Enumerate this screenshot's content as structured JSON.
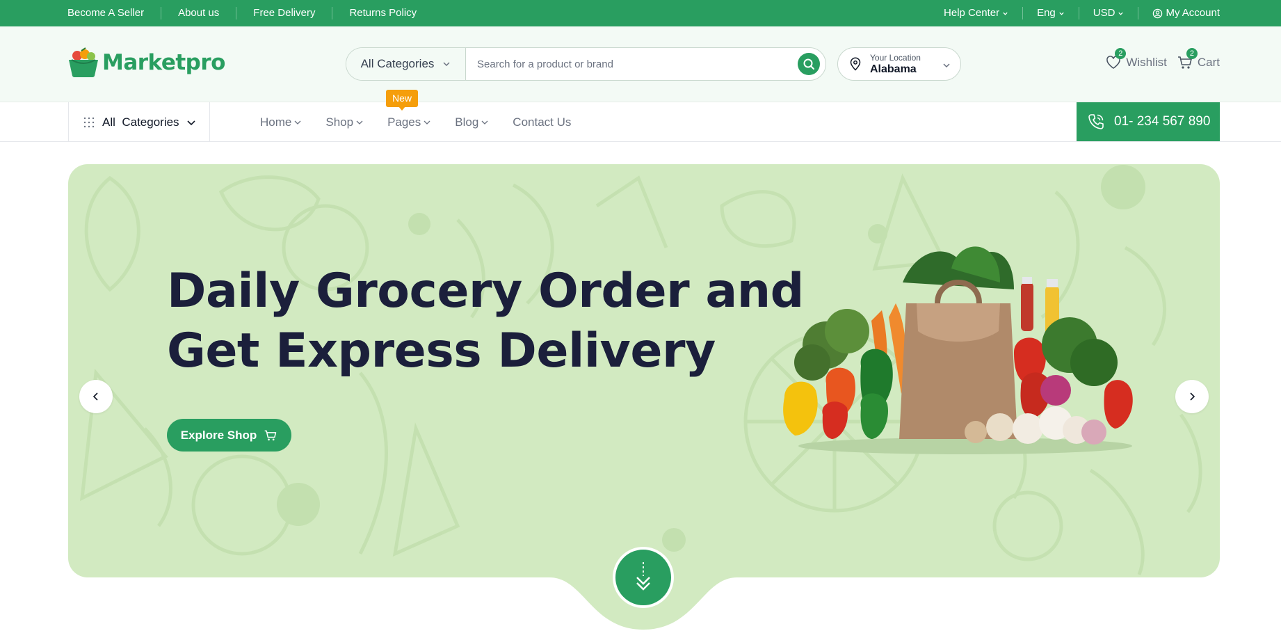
{
  "topbar": {
    "links": [
      "Become A Seller",
      "About us",
      "Free Delivery",
      "Returns Policy"
    ],
    "help_center": "Help Center",
    "language": "Eng",
    "currency": "USD",
    "account": "My Account"
  },
  "header": {
    "logo_text": "Marketpro",
    "search": {
      "category_label": "All Categories",
      "placeholder": "Search for a product or brand"
    },
    "location": {
      "label": "Your Location",
      "value": "Alabama"
    },
    "wishlist": {
      "label": "Wishlist",
      "count": "2"
    },
    "cart": {
      "label": "Cart",
      "count": "2"
    }
  },
  "nav": {
    "all_categories": "All  Categories",
    "menu": [
      {
        "label": "Home"
      },
      {
        "label": "Shop"
      },
      {
        "label": "Pages"
      },
      {
        "label": "Blog"
      },
      {
        "label": "Contact Us"
      }
    ],
    "new_tag": "New",
    "phone": "01- 234 567 890"
  },
  "hero": {
    "headline_line1": "Daily Grocery Order and",
    "headline_line2": "Get Express Delivery",
    "cta_label": "Explore Shop"
  },
  "colors": {
    "primary": "#299e60",
    "hero_bg": "#d2eac1",
    "header_bg": "#f3faf5",
    "new_tag": "#f59e0b",
    "headline": "#1b1f3b"
  }
}
